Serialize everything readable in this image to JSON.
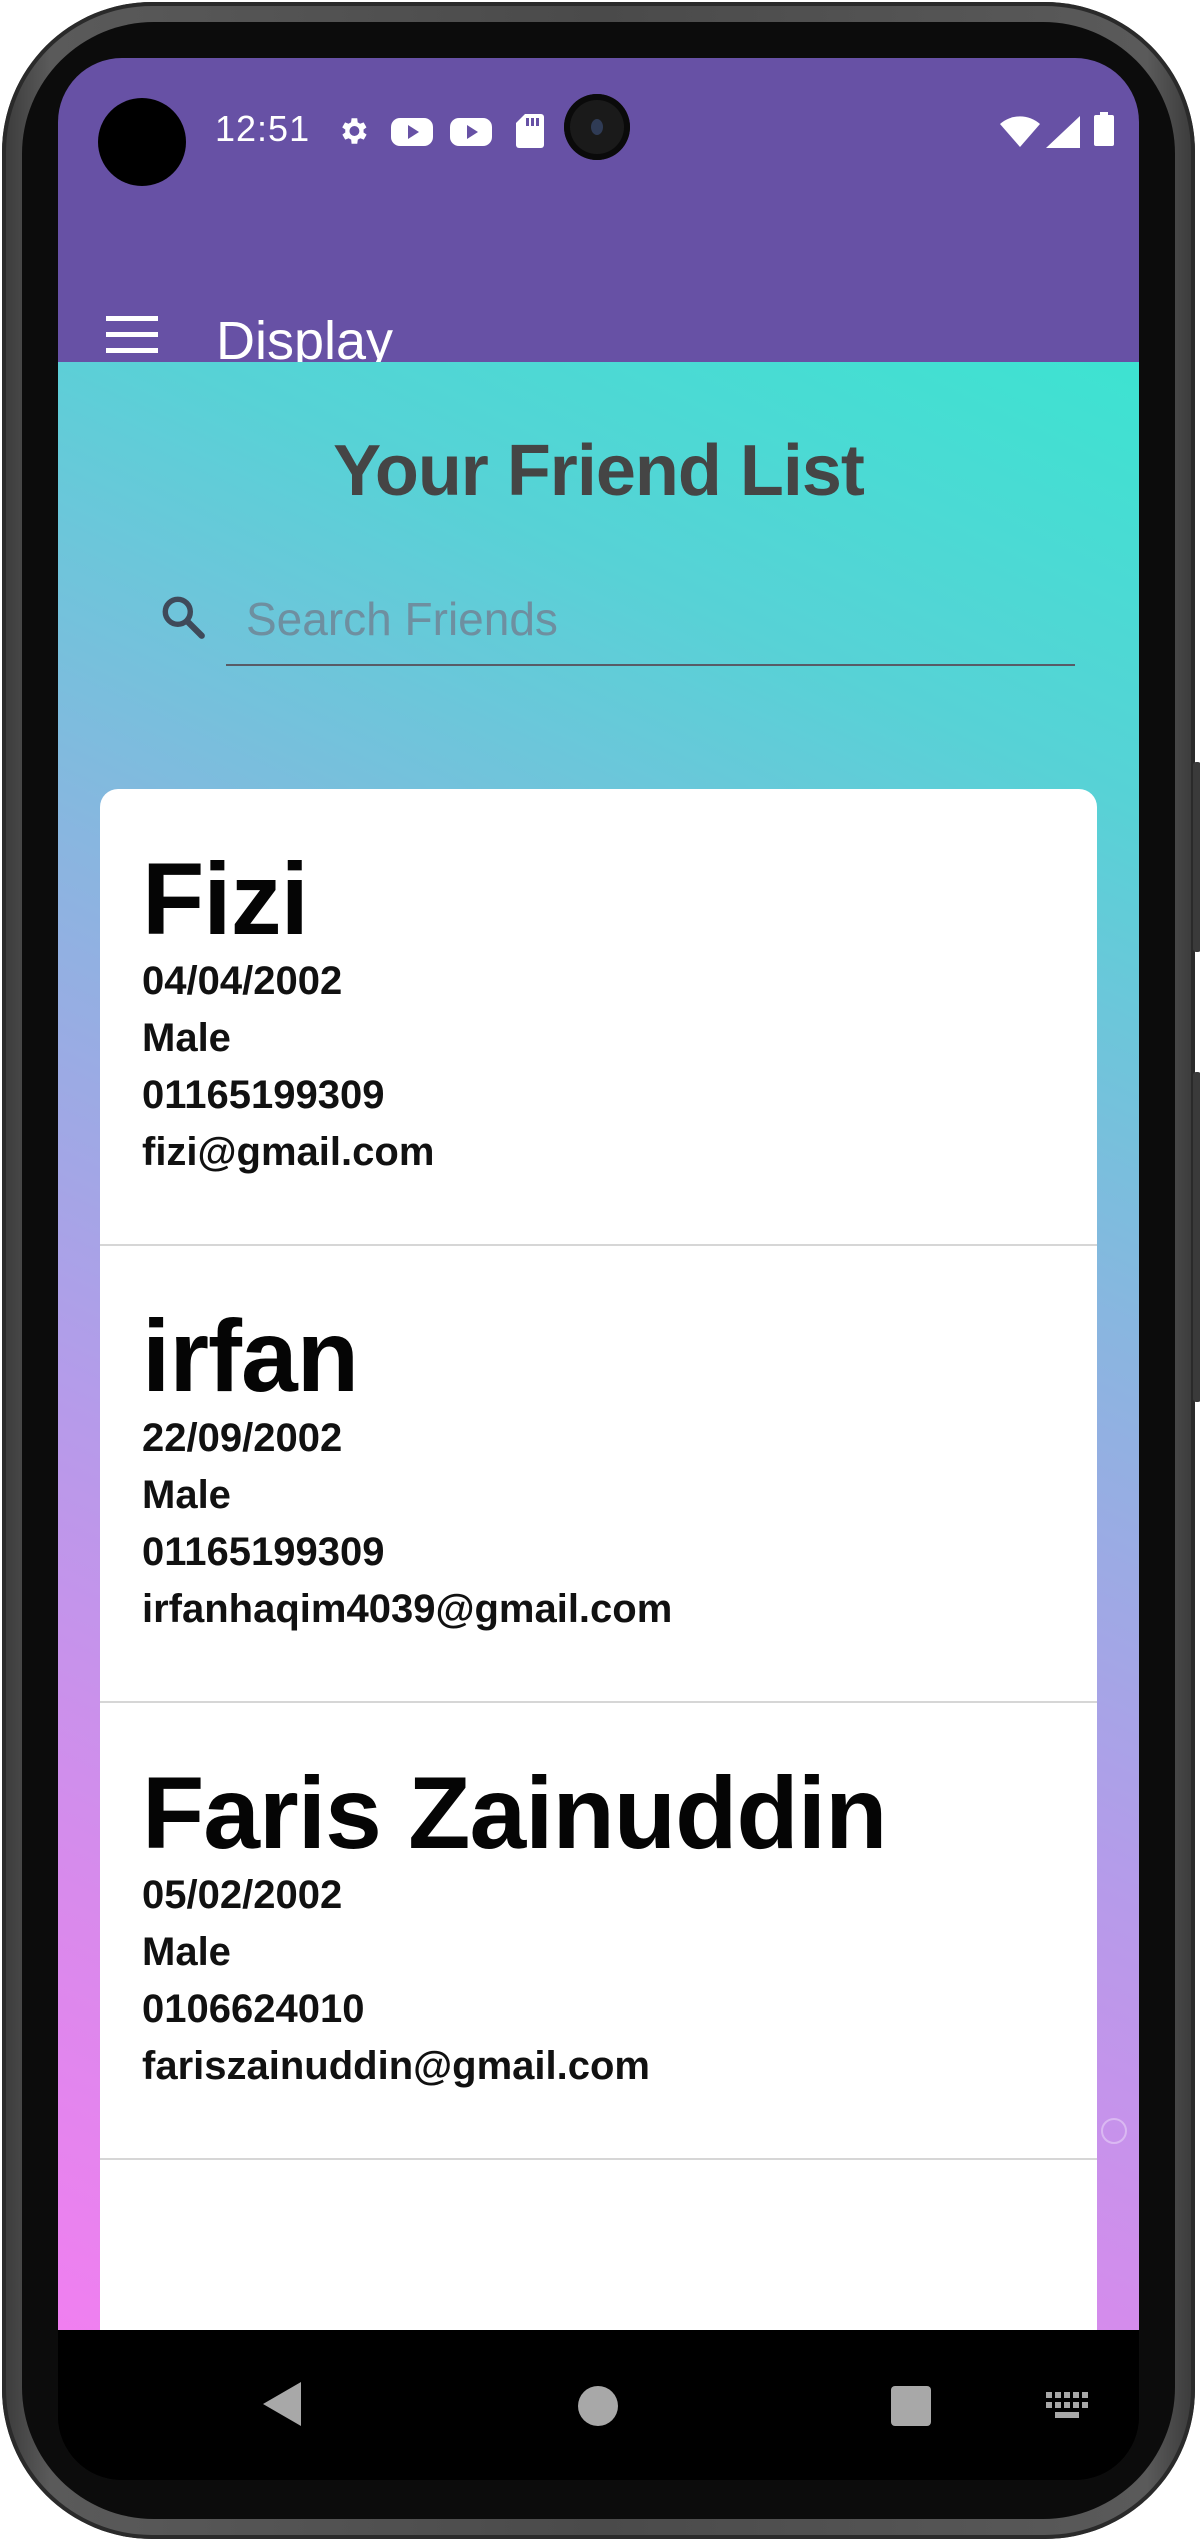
{
  "status_bar": {
    "time": "12:51",
    "icons": [
      "settings-icon",
      "youtube-icon",
      "youtube-icon",
      "sd-card-icon",
      "wifi-icon",
      "signal-icon",
      "battery-icon"
    ]
  },
  "toolbar": {
    "menu_icon": "menu-icon",
    "title": "Display"
  },
  "main": {
    "title": "Your Friend List",
    "search": {
      "placeholder": "Search Friends",
      "value": ""
    },
    "friends": [
      {
        "name": "Fizi",
        "dob": "04/04/2002",
        "gender": "Male",
        "phone": "01165199309",
        "email": "fizi@gmail.com"
      },
      {
        "name": "irfan",
        "dob": "22/09/2002",
        "gender": "Male",
        "phone": "01165199309",
        "email": "irfanhaqim4039@gmail.com"
      },
      {
        "name": "Faris Zainuddin",
        "dob": "05/02/2002",
        "gender": "Male",
        "phone": "0106624010",
        "email": "fariszainuddin@gmail.com"
      }
    ]
  },
  "navigation_bar": {
    "icons": [
      "back-icon",
      "home-icon",
      "recents-icon",
      "keyboard-icon"
    ]
  },
  "colors": {
    "appbar": "#6751a5",
    "gradient_top": "#3de3d1",
    "gradient_bottom": "#f07ff0",
    "title_text": "#454545"
  }
}
